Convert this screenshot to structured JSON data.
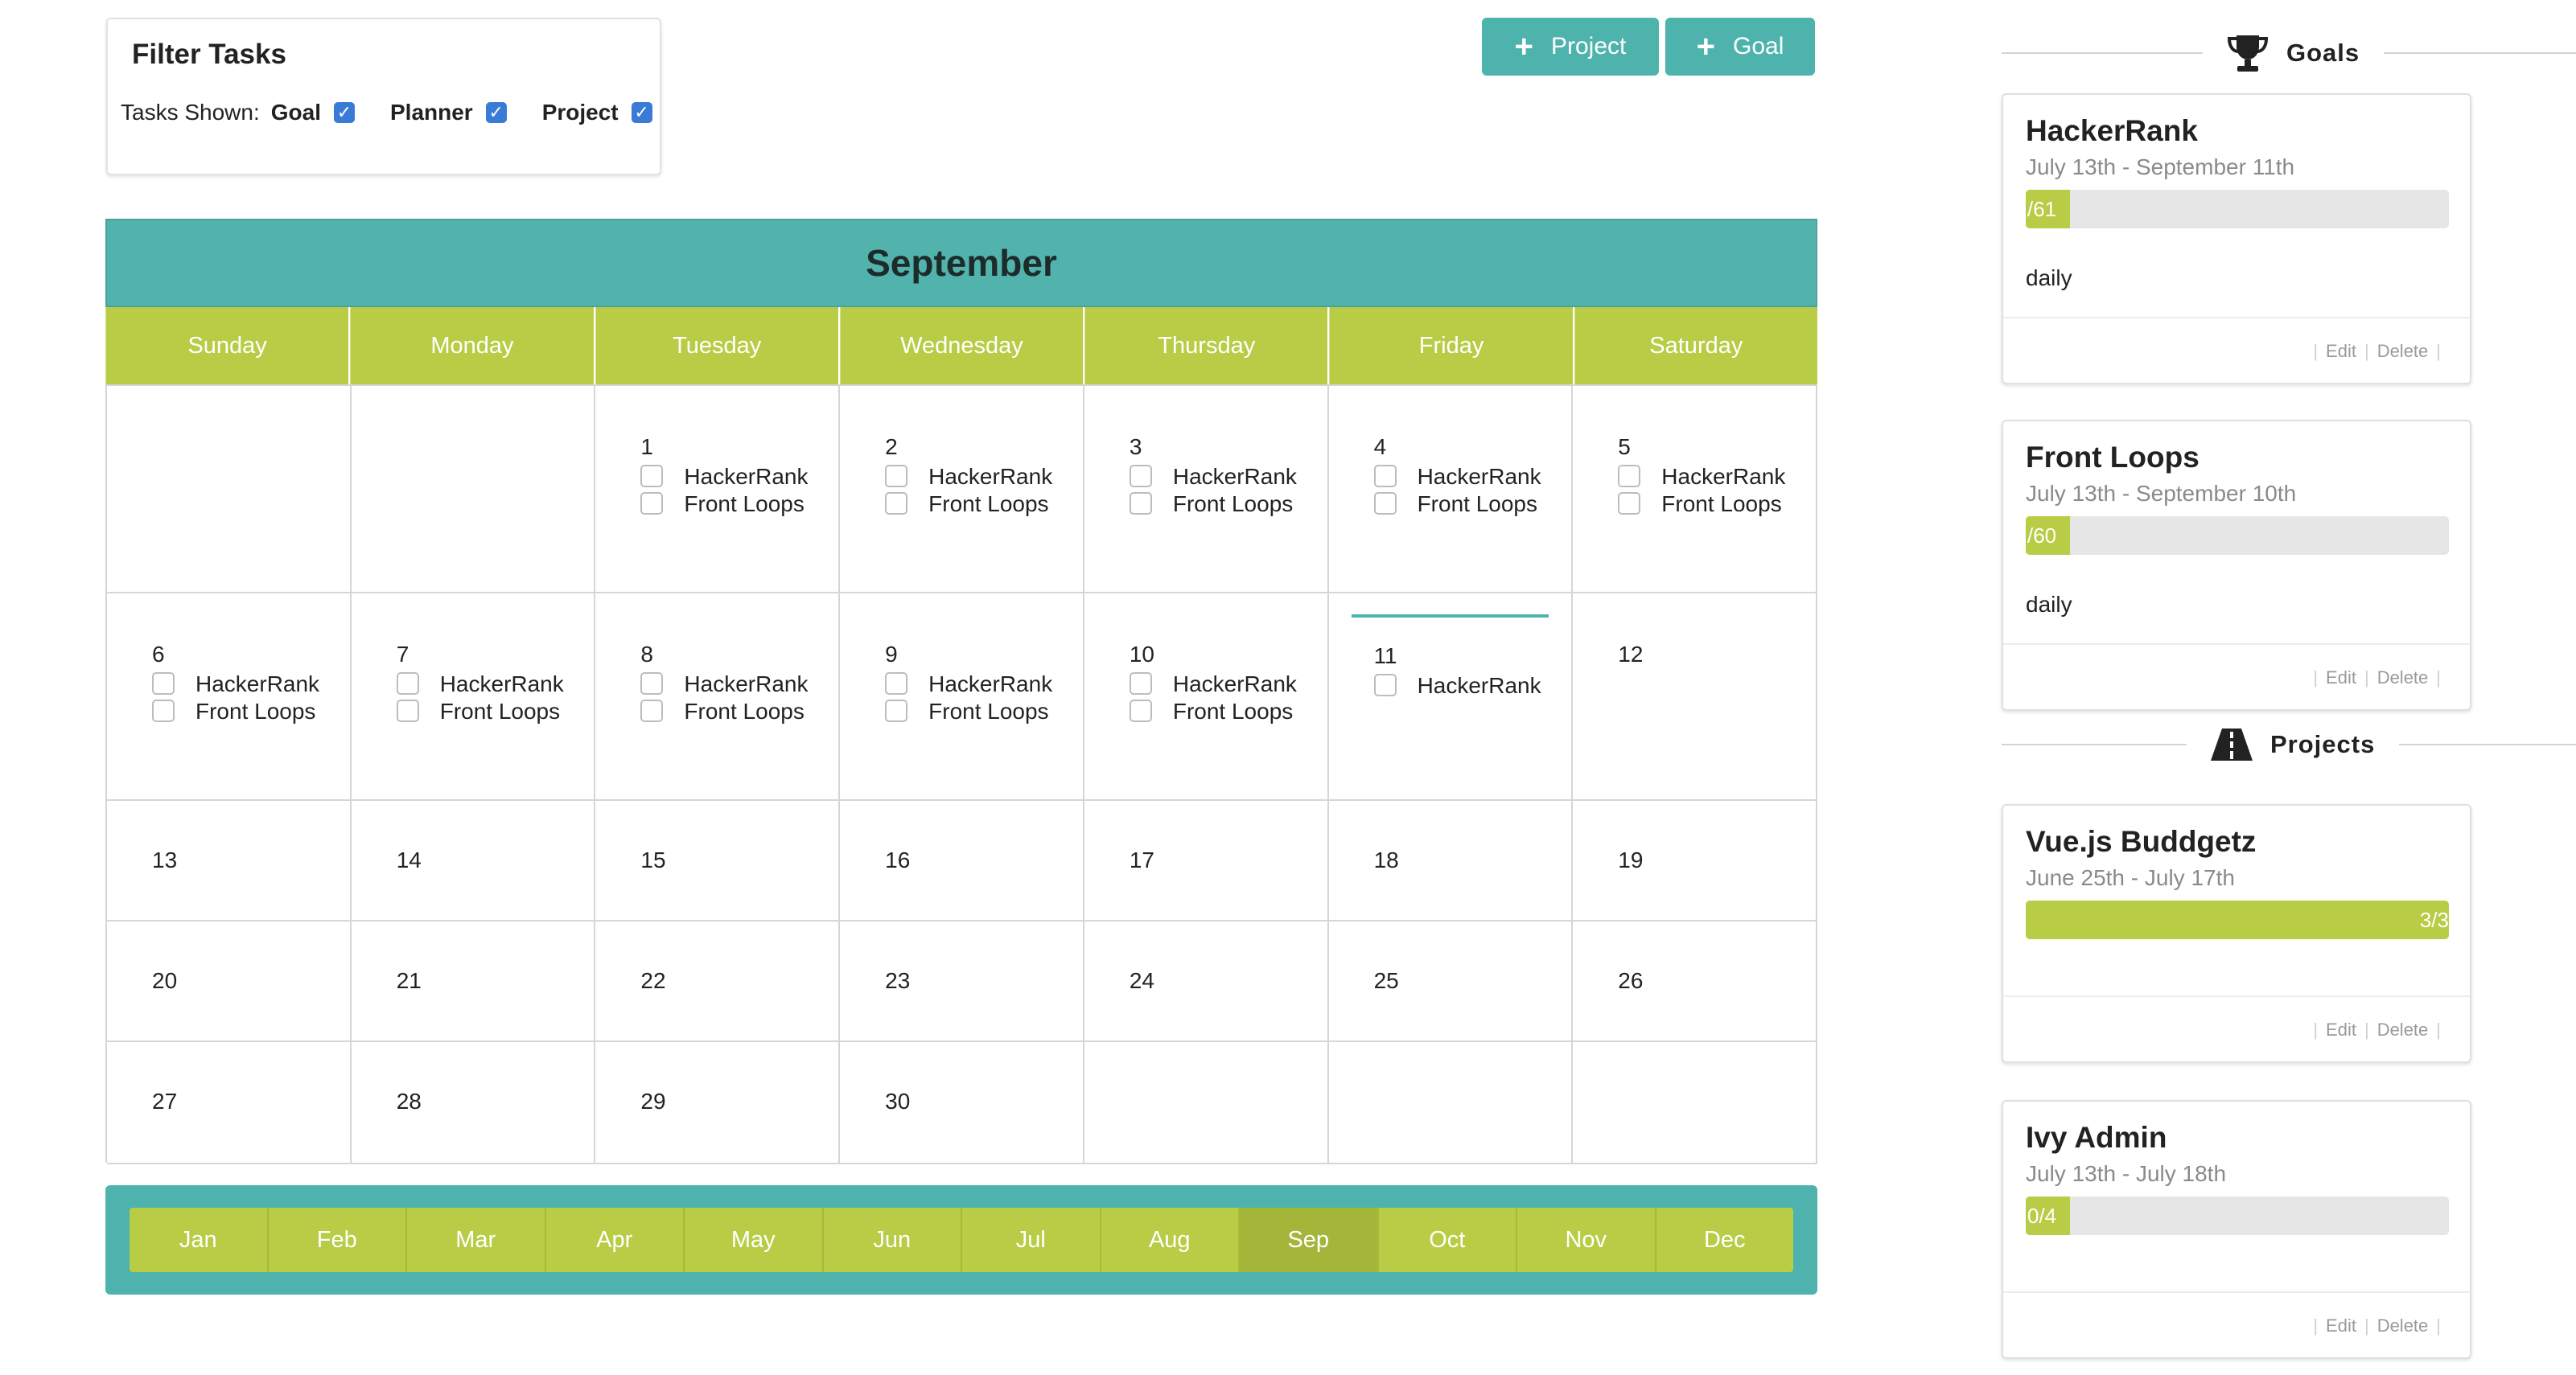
{
  "filter": {
    "title": "Filter Tasks",
    "label": "Tasks Shown:",
    "options": [
      {
        "label": "Goal",
        "checked": true
      },
      {
        "label": "Planner",
        "checked": true
      },
      {
        "label": "Project",
        "checked": true
      }
    ]
  },
  "buttons": {
    "project": "Project",
    "goal": "Goal"
  },
  "calendar": {
    "month": "September",
    "weekdays": [
      "Sunday",
      "Monday",
      "Tuesday",
      "Wednesday",
      "Thursday",
      "Friday",
      "Saturday"
    ],
    "days": [
      {
        "n": ""
      },
      {
        "n": ""
      },
      {
        "n": "1",
        "tasks": [
          "HackerRank",
          "Front Loops"
        ]
      },
      {
        "n": "2",
        "tasks": [
          "HackerRank",
          "Front Loops"
        ]
      },
      {
        "n": "3",
        "tasks": [
          "HackerRank",
          "Front Loops"
        ]
      },
      {
        "n": "4",
        "tasks": [
          "HackerRank",
          "Front Loops"
        ]
      },
      {
        "n": "5",
        "tasks": [
          "HackerRank",
          "Front Loops"
        ]
      },
      {
        "n": "6",
        "tasks": [
          "HackerRank",
          "Front Loops"
        ]
      },
      {
        "n": "7",
        "tasks": [
          "HackerRank",
          "Front Loops"
        ]
      },
      {
        "n": "8",
        "tasks": [
          "HackerRank",
          "Front Loops"
        ]
      },
      {
        "n": "9",
        "tasks": [
          "HackerRank",
          "Front Loops"
        ]
      },
      {
        "n": "10",
        "tasks": [
          "HackerRank",
          "Front Loops"
        ]
      },
      {
        "n": "11",
        "tasks": [
          "HackerRank"
        ],
        "today": true
      },
      {
        "n": "12"
      },
      {
        "n": "13"
      },
      {
        "n": "14"
      },
      {
        "n": "15"
      },
      {
        "n": "16"
      },
      {
        "n": "17"
      },
      {
        "n": "18"
      },
      {
        "n": "19"
      },
      {
        "n": "20"
      },
      {
        "n": "21"
      },
      {
        "n": "22"
      },
      {
        "n": "23"
      },
      {
        "n": "24"
      },
      {
        "n": "25"
      },
      {
        "n": "26"
      },
      {
        "n": "27"
      },
      {
        "n": "28"
      },
      {
        "n": "29"
      },
      {
        "n": "30"
      },
      {
        "n": ""
      },
      {
        "n": ""
      },
      {
        "n": ""
      }
    ]
  },
  "months": [
    "Jan",
    "Feb",
    "Mar",
    "Apr",
    "May",
    "Jun",
    "Jul",
    "Aug",
    "Sep",
    "Oct",
    "Nov",
    "Dec"
  ],
  "active_month": "Sep",
  "goals_section": {
    "label": "Goals"
  },
  "projects_section": {
    "label": "Projects"
  },
  "goals": [
    {
      "title": "HackerRank",
      "dates": "July 13th - September 11th",
      "progress_label": "/61",
      "progress_fraction": 0.05,
      "frequency": "daily",
      "edit": "Edit",
      "delete": "Delete"
    },
    {
      "title": "Front Loops",
      "dates": "July 13th - September 10th",
      "progress_label": "/60",
      "progress_fraction": 0.05,
      "frequency": "daily",
      "edit": "Edit",
      "delete": "Delete"
    }
  ],
  "projects": [
    {
      "title": "Vue.js Buddgetz",
      "dates": "June 25th - July 17th",
      "progress_label": "3/3",
      "progress_fraction": 1.0,
      "edit": "Edit",
      "delete": "Delete"
    },
    {
      "title": "Ivy Admin",
      "dates": "July 13th - July 18th",
      "progress_label": "0/4",
      "progress_fraction": 0.05,
      "edit": "Edit",
      "delete": "Delete"
    }
  ],
  "colors": {
    "teal": "#4fb3ad",
    "green": "#b8cc45",
    "active_month": "#a4b63a",
    "checkbox": "#3a7bd5"
  }
}
